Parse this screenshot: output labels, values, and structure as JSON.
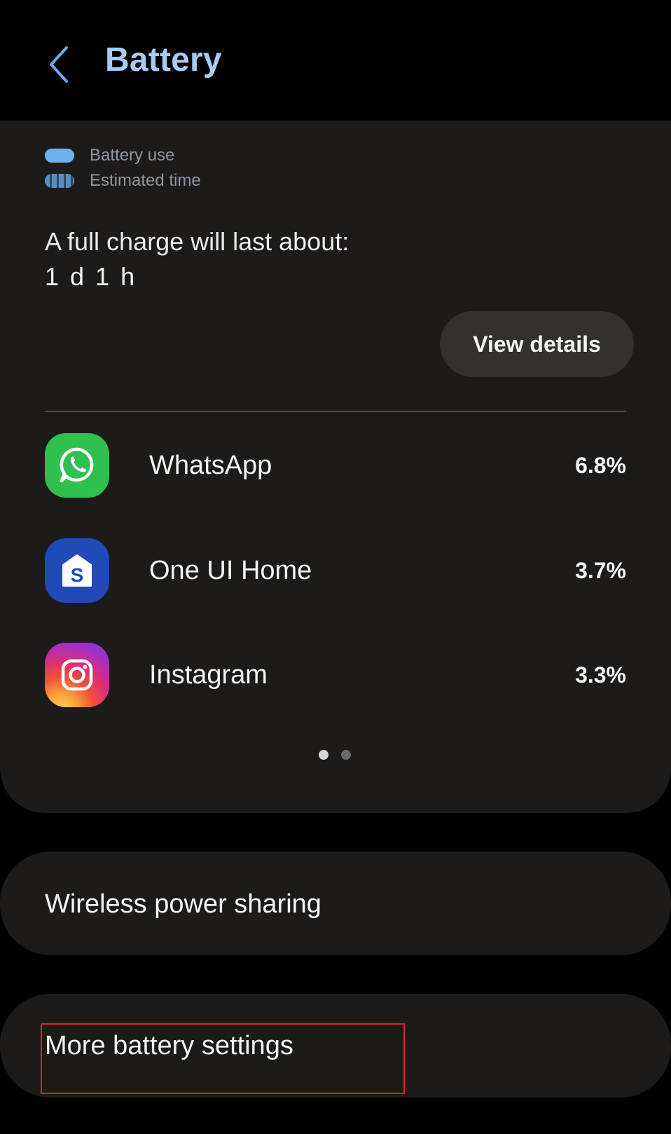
{
  "header": {
    "title": "Battery",
    "back_icon": "chevron-left-icon",
    "accent_color": "#a9cbf2"
  },
  "legend": {
    "items": [
      {
        "label": "Battery use",
        "style": "solid",
        "color": "#6fb1ec"
      },
      {
        "label": "Estimated time",
        "style": "striped",
        "color": "#5b8fc0"
      }
    ]
  },
  "charge": {
    "label": "A full charge will last about:",
    "value": "1 d 1 h"
  },
  "view_details_label": "View details",
  "apps": [
    {
      "name": "WhatsApp",
      "percent": "6.8%",
      "icon": "whatsapp-icon",
      "color": "#2fc04f"
    },
    {
      "name": "One UI Home",
      "percent": "3.7%",
      "icon": "one-ui-home-icon",
      "color": "#1f4ab8",
      "glyph": "S"
    },
    {
      "name": "Instagram",
      "percent": "3.3%",
      "icon": "instagram-icon"
    }
  ],
  "pager": {
    "pages": 2,
    "active": 1
  },
  "settings": {
    "wireless_label": "Wireless power sharing",
    "more_label": "More battery settings"
  },
  "highlight_color": "#e0202a"
}
